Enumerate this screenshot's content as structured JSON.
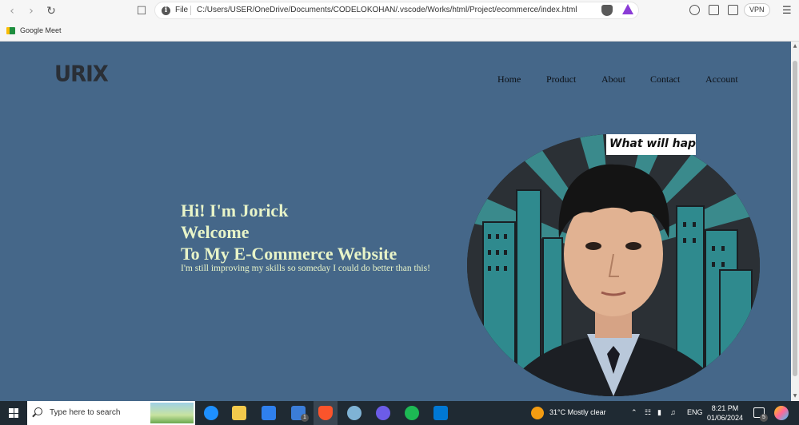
{
  "browser": {
    "scheme_label": "File",
    "url": "C:/Users/USER/OneDrive/Documents/CODELOKOHAN/.vscode/Works/html/Project/ecommerce/index.html",
    "vpn_label": "VPN",
    "bookmark_label": "Google Meet"
  },
  "site": {
    "logo": "URIX",
    "nav": [
      "Home",
      "Product",
      "About",
      "Contact",
      "Account"
    ],
    "hero_line1": "Hi! I'm Jorick",
    "hero_line2": "Welcome",
    "hero_line3": "To My E-Commerce Website",
    "hero_sub": "I'm still improving my skills so someday I could do better than this!",
    "comic_text": "What will happen"
  },
  "taskbar": {
    "search_placeholder": "Type here to search",
    "weather": "31°C  Mostly clear",
    "lang": "ENG",
    "time": "8:21 PM",
    "date": "01/06/2024",
    "mail_badge": "1",
    "notif_badge": "5"
  },
  "colors": {
    "page_bg": "#456789",
    "hero_text": "#e8f4c8",
    "nav_text": "#0d1117"
  }
}
